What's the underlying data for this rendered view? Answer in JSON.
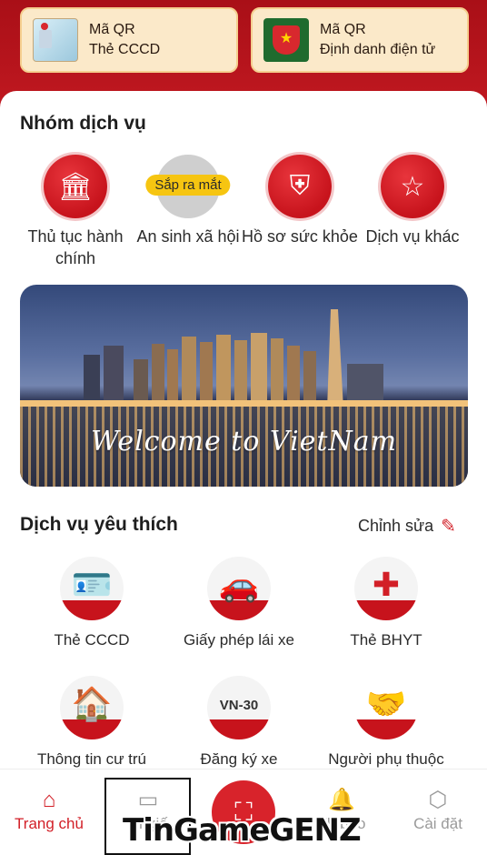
{
  "qr_cards": [
    {
      "line1": "Mã QR",
      "line2": "Thẻ CCCD"
    },
    {
      "line1": "Mã QR",
      "line2": "Định danh điện tử"
    }
  ],
  "service_group": {
    "title": "Nhóm dịch vụ",
    "items": [
      {
        "label": "Thủ tục hành chính",
        "icon": "government-building-icon"
      },
      {
        "label": "An sinh xã hội",
        "icon": "social-security-icon",
        "badge": "Sắp ra mắt"
      },
      {
        "label": "Hồ sơ sức khỏe",
        "icon": "health-shield-icon"
      },
      {
        "label": "Dịch vụ khác",
        "icon": "star-podium-icon"
      }
    ]
  },
  "banner": {
    "text": "Welcome to VietNam"
  },
  "favorites": {
    "title": "Dịch vụ yêu thích",
    "edit_label": "Chỉnh sửa",
    "items": [
      {
        "label": "Thẻ CCCD",
        "icon": "id-card-icon"
      },
      {
        "label": "Giấy phép lái xe",
        "icon": "car-license-icon"
      },
      {
        "label": "Thẻ BHYT",
        "icon": "health-insurance-icon"
      },
      {
        "label": "Thông tin cư trú",
        "icon": "residence-icon"
      },
      {
        "label": "Đăng ký xe",
        "icon": "vehicle-plate-icon",
        "plate": "VN-30"
      },
      {
        "label": "Người phụ thuộc",
        "icon": "dependents-icon"
      }
    ]
  },
  "bottom_nav": {
    "home": "Trang chủ",
    "wallet": "Ví giấ",
    "notifications": "Th báo",
    "settings": "Cài đặt"
  },
  "watermark": "TinGameGENZ",
  "colors": {
    "brand_red": "#d21f27",
    "badge_yellow": "#f6c511",
    "card_cream": "#fbe9c9"
  }
}
